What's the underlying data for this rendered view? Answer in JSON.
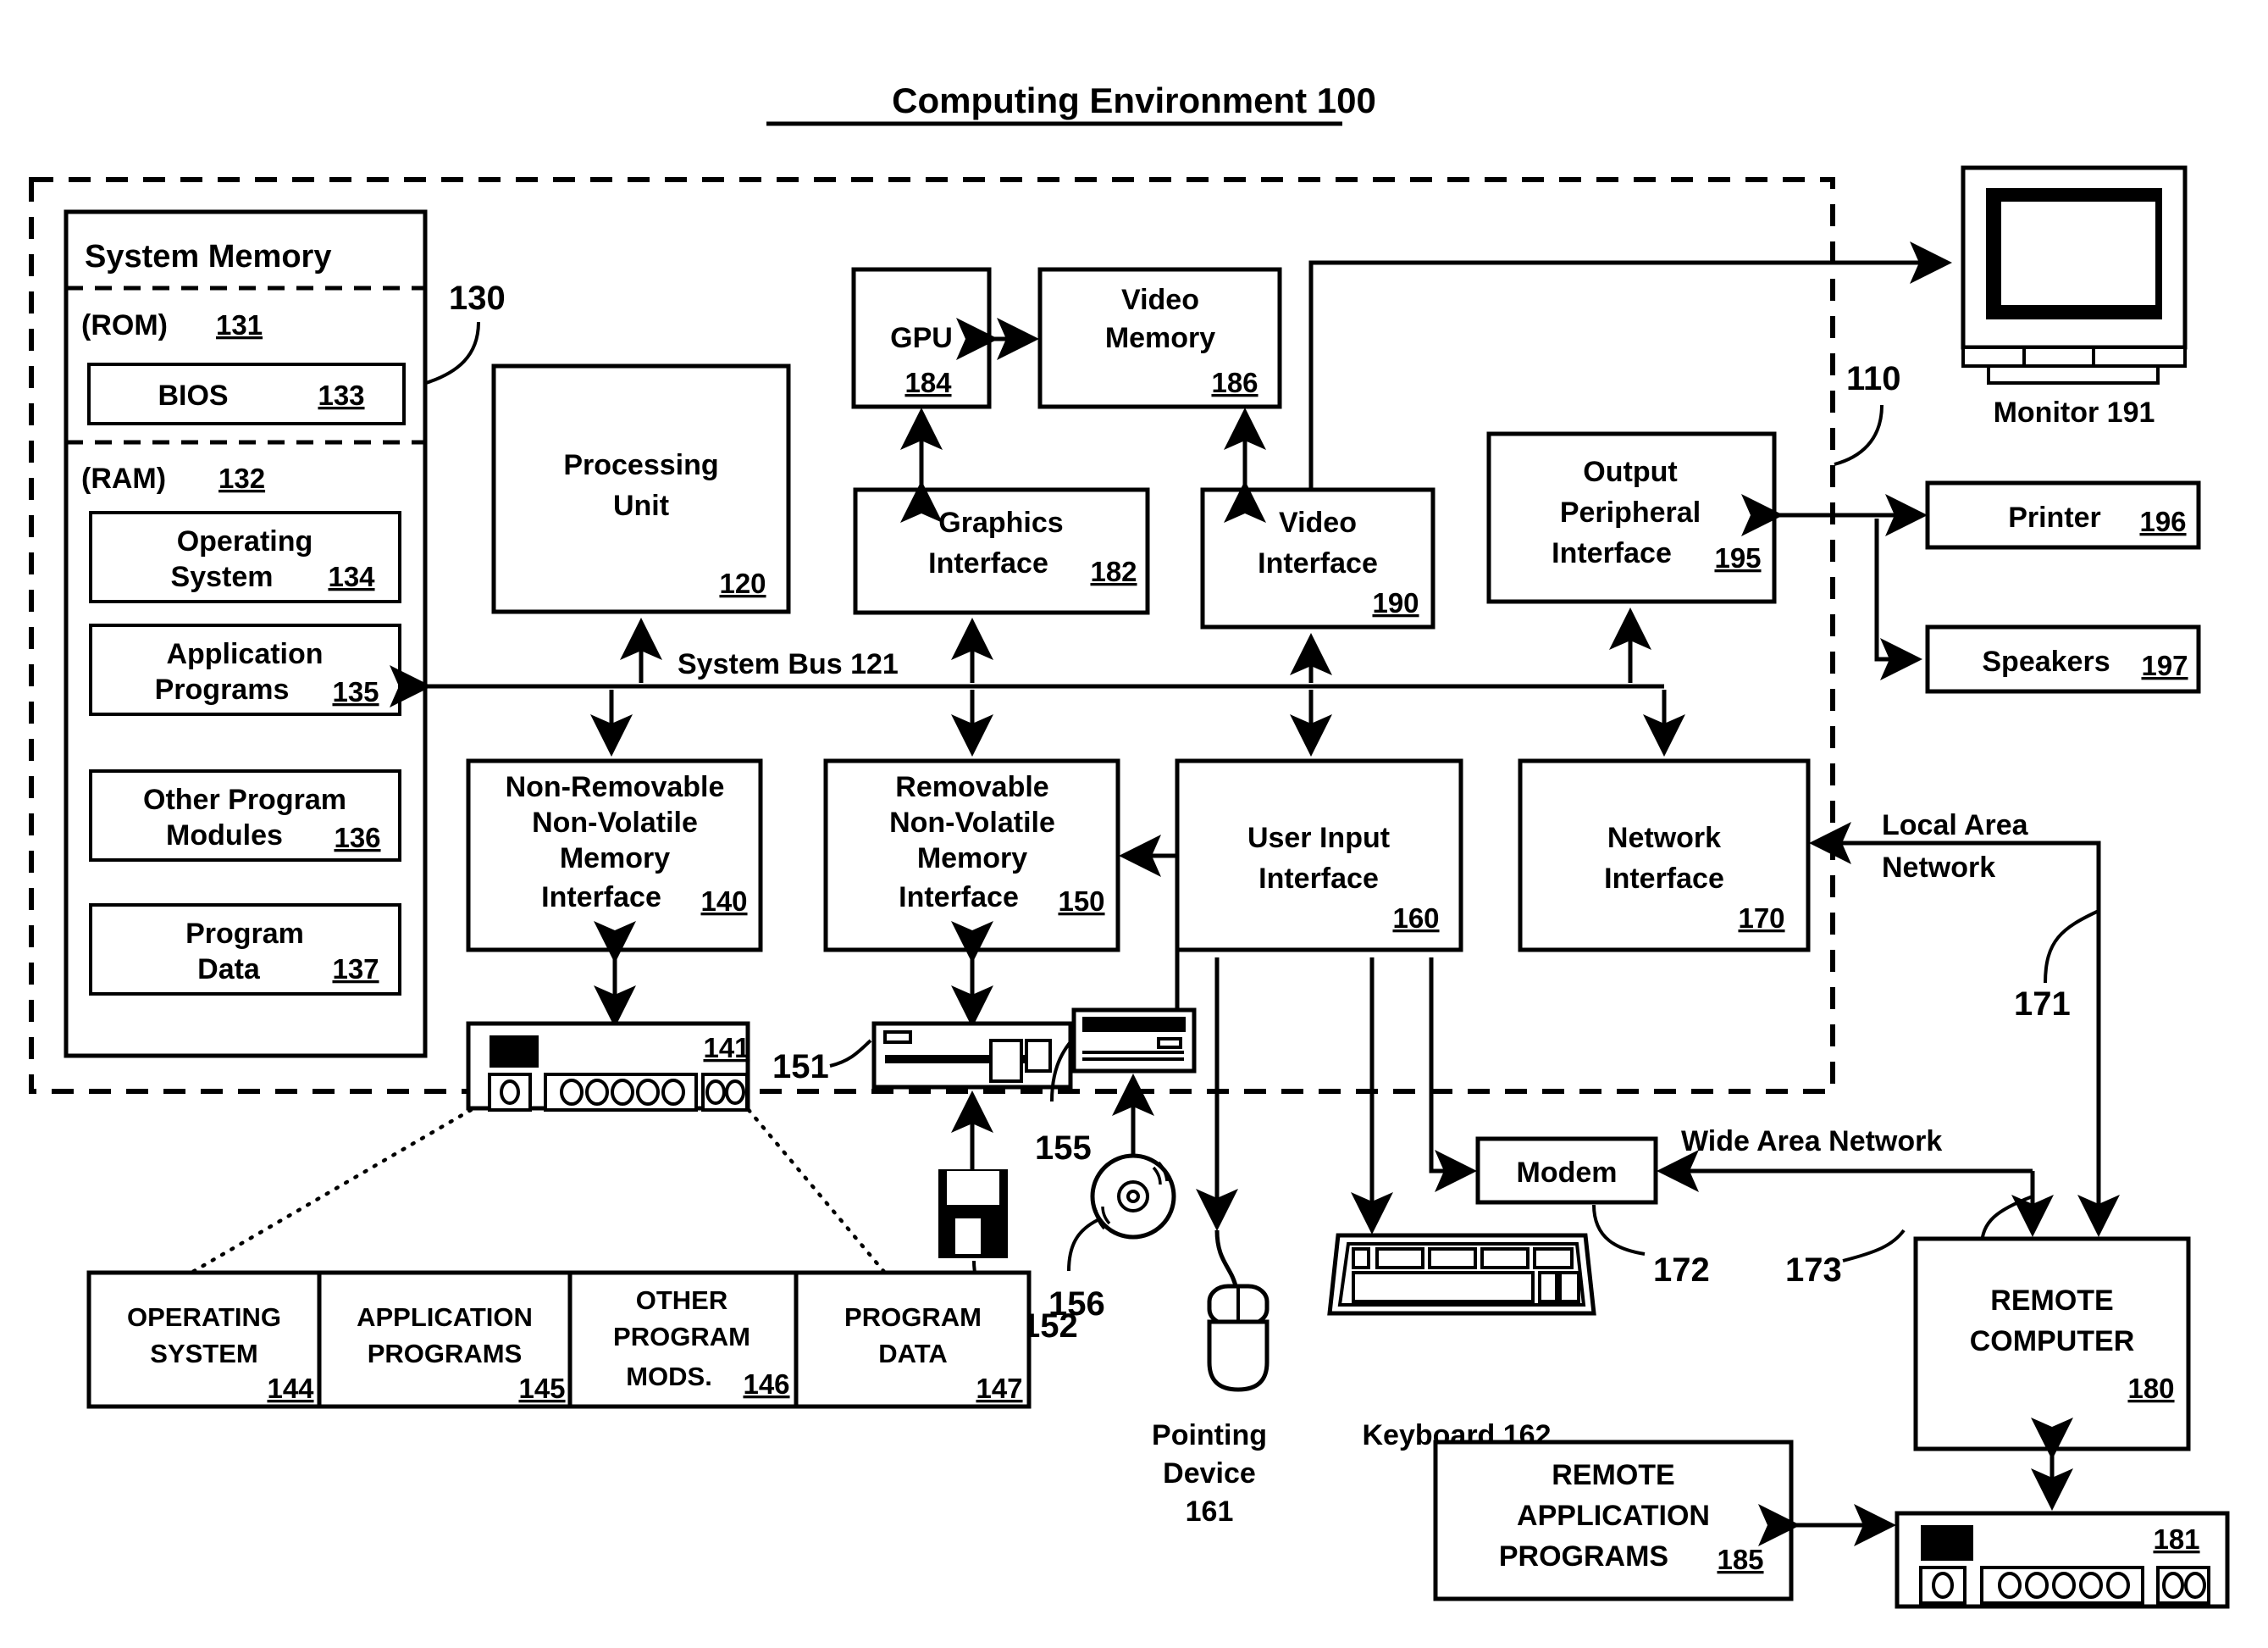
{
  "figure": {
    "title": "Computing Environment 100",
    "title_ref": "100"
  },
  "refs": {
    "computer_110": "110",
    "system_memory_130": "130",
    "bus_label": "System Bus 121",
    "lan_ref": "171",
    "modem_ref": "172",
    "wan_ref": "173",
    "hdd_ref": "141",
    "floppy_drive_ref": "151",
    "floppy_disk_ref": "152",
    "optical_drive_ref": "155",
    "optical_disc_ref": "156",
    "remote_storage_ref": "181"
  },
  "memory": {
    "header": "System Memory",
    "rom_label": "(ROM)",
    "rom_num": "131",
    "bios_label": "BIOS",
    "bios_num": "133",
    "ram_label": "(RAM)",
    "ram_num": "132",
    "items": [
      {
        "line1": "Operating",
        "line2": "System",
        "num": "134"
      },
      {
        "line1": "Application",
        "line2": "Programs",
        "num": "135"
      },
      {
        "line1": "Other Program",
        "line2": "Modules",
        "num": "136"
      },
      {
        "line1": "Program",
        "line2": "Data",
        "num": "137"
      }
    ]
  },
  "blocks": {
    "processing_unit": {
      "line1": "Processing",
      "line2": "Unit",
      "num": "120"
    },
    "gpu": {
      "line1": "GPU",
      "num": "184"
    },
    "video_memory": {
      "line1": "Video",
      "line2": "Memory",
      "num": "186"
    },
    "graphics_interface": {
      "line1": "Graphics",
      "line2": "Interface",
      "num": "182"
    },
    "video_interface": {
      "line1": "Video",
      "line2": "Interface",
      "num": "190"
    },
    "output_peripheral_interface": {
      "line1": "Output",
      "line2": "Peripheral",
      "line3": "Interface",
      "num": "195"
    },
    "nonremovable_memory_interface": {
      "line1": "Non-Removable",
      "line2": "Non-Volatile",
      "line3": "Memory",
      "line4": "Interface",
      "num": "140"
    },
    "removable_memory_interface": {
      "line1": "Removable",
      "line2": "Non-Volatile",
      "line3": "Memory",
      "line4": "Interface",
      "num": "150"
    },
    "user_input_interface": {
      "line1": "User Input",
      "line2": "Interface",
      "num": "160"
    },
    "network_interface": {
      "line1": "Network",
      "line2": "Interface",
      "num": "170"
    },
    "modem": {
      "label": "Modem"
    },
    "remote_computer": {
      "line1": "REMOTE",
      "line2": "COMPUTER",
      "num": "180"
    },
    "remote_application_programs": {
      "line1": "REMOTE",
      "line2": "APPLICATION",
      "line3": "PROGRAMS",
      "num": "185"
    }
  },
  "peripherals": {
    "monitor": {
      "label": "Monitor 191"
    },
    "printer": {
      "label": "Printer",
      "num": "196"
    },
    "speakers": {
      "label": "Speakers",
      "num": "197"
    },
    "pointing_device": {
      "line1": "Pointing",
      "line2": "Device",
      "line3": "161"
    },
    "keyboard": {
      "label": "Keyboard 162"
    }
  },
  "networks": {
    "local_area": {
      "line1": "Local Area",
      "line2": "Network"
    },
    "wide_area": {
      "label": "Wide Area Network"
    }
  },
  "storage_table": {
    "columns": [
      {
        "line1": "OPERATING",
        "line2": "SYSTEM",
        "num": "144"
      },
      {
        "line1": "APPLICATION",
        "line2": "PROGRAMS",
        "num": "145"
      },
      {
        "line1": "OTHER",
        "line2": "PROGRAM",
        "line3": "MODS.",
        "num": "146"
      },
      {
        "line1": "PROGRAM",
        "line2": "DATA",
        "num": "147"
      }
    ]
  },
  "colors": {
    "ink": "#000000",
    "paper": "#ffffff"
  }
}
